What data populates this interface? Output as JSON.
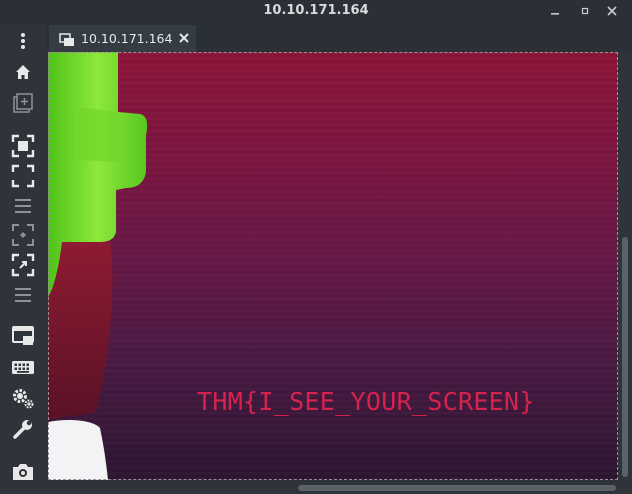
{
  "window": {
    "title": "10.10.171.164"
  },
  "tabs": [
    {
      "label": "10.10.171.164"
    }
  ],
  "toolbar": {
    "items": [
      {
        "icon": "menu-icon"
      },
      {
        "icon": "home-icon"
      },
      {
        "icon": "new-connection-icon"
      },
      {
        "icon": "fit-window-icon"
      },
      {
        "icon": "fullscreen-icon"
      },
      {
        "icon": "scale-icon"
      },
      {
        "icon": "scaled-fit-icon"
      },
      {
        "icon": "dynamic-resolution-icon"
      },
      {
        "icon": "toggle-view-icon"
      },
      {
        "icon": "multi-monitor-icon"
      },
      {
        "icon": "keyboard-icon"
      },
      {
        "icon": "preferences-icon"
      },
      {
        "icon": "tools-icon"
      },
      {
        "icon": "screenshot-icon"
      }
    ]
  },
  "remote_screen": {
    "flag_text": "THM{I_SEE_YOUR_SCREEN}"
  },
  "colors": {
    "accent_flag": "#d6234d",
    "background_top": "#8c1538",
    "background_bottom": "#2c1632"
  }
}
